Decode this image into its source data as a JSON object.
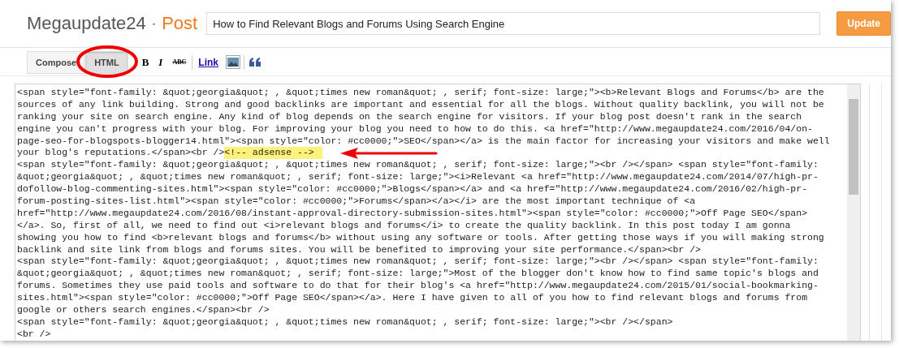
{
  "header": {
    "blog_name": "Megaupdate24",
    "separator": "·",
    "page_kind": "Post",
    "title_value": "How to Find Relevant Blogs and Forums Using Search Engine",
    "update_button": "Update"
  },
  "mode_tabs": [
    {
      "label": "Compose",
      "selected": false
    },
    {
      "label": "HTML",
      "selected": true
    }
  ],
  "toolbar": [
    {
      "kind": "bold",
      "label": "B"
    },
    {
      "kind": "italic",
      "label": "I"
    },
    {
      "kind": "strike",
      "label": "ABC"
    },
    {
      "kind": "link",
      "label": "Link"
    },
    {
      "kind": "image"
    },
    {
      "kind": "quote"
    }
  ],
  "code_lines": [
    {
      "text": "<span style=\"font-family: &quot;georgia&quot; , &quot;times new roman&quot; , serif; font-size: large;\"><b>Relevant Blogs and Forums</b> are the"
    },
    {
      "text": "sources of any link building. Strong and good backlinks are important and essential for all the blogs. Without quality backlink, you will not be"
    },
    {
      "text": "ranking your site on search engine. Any kind of blog depends on the search engine for visitors. If your blog post doesn't rank in the search"
    },
    {
      "text": "engine you can't progress with your blog. For improving your blog you need to how to do this. <a href=\"http://www.megaupdate24.com/2016/04/on-"
    },
    {
      "text": "page-seo-for-blogspots-blogger14.html\"><span style=\"color: #cc0000;\">SEO</span></a> is the main factor for increasing your visitors and make well"
    },
    {
      "text": "your blog's reputations.</span><br />",
      "highlight": "<!-- adsense -->"
    },
    {
      "text": "<span style=\"font-family: &quot;georgia&quot; , &quot;times new roman&quot; , serif; font-size: large;\"><br /></span> <span style=\"font-family:"
    },
    {
      "text": "&quot;georgia&quot; , &quot;times new roman&quot; , serif; font-size: large;\"><i>Relevant <a href=\"http://www.megaupdate24.com/2014/07/high-pr-"
    },
    {
      "text": "dofollow-blog-commenting-sites.html\"><span style=\"color: #cc0000;\">Blogs</span></a> and <a href=\"http://www.megaupdate24.com/2016/02/high-pr-"
    },
    {
      "text": "forum-posting-sites-list.html\"><span style=\"color: #cc0000;\">Forums</span></a></i> are the most important technique of <a"
    },
    {
      "text": "href=\"http://www.megaupdate24.com/2016/08/instant-approval-directory-submission-sites.html\"><span style=\"color: #cc0000;\">Off Page SEO</span>"
    },
    {
      "text": "</a>. So, first of all, we need to find out <i>relevant blogs and forums</i> to create the quality backlink. In this post today I am gonna"
    },
    {
      "text": "showing you how to find <b>relevant blogs and forums</b> without using any software or tools. After getting those ways if you will making strong"
    },
    {
      "text": "backlink and site link from blogs and forums sites. You will be benefited to improving your site performance.</span><br />"
    },
    {
      "text": "<span style=\"font-family: &quot;georgia&quot; , &quot;times new roman&quot; , serif; font-size: large;\"><br /></span> <span style=\"font-family:"
    },
    {
      "text": "&quot;georgia&quot; , &quot;times new roman&quot; , serif; font-size: large;\">Most of the blogger don't know how to find same topic's blogs and"
    },
    {
      "text": "forums. Sometimes they use paid tools and software to do that for their blog's <a href=\"http://www.megaupdate24.com/2015/01/social-bookmarking-"
    },
    {
      "text": "sites.html\"><span style=\"color: #cc0000;\">Off Page SEO</span></a>. Here I have given to all of you how to find relevant blogs and forums from"
    },
    {
      "text": "google or others search engines.</span><br />"
    },
    {
      "text": "<span style=\"font-family: &quot;georgia&quot; , &quot;times new roman&quot; , serif; font-size: large;\"><br /></span>"
    },
    {
      "text": "<br />"
    }
  ]
}
